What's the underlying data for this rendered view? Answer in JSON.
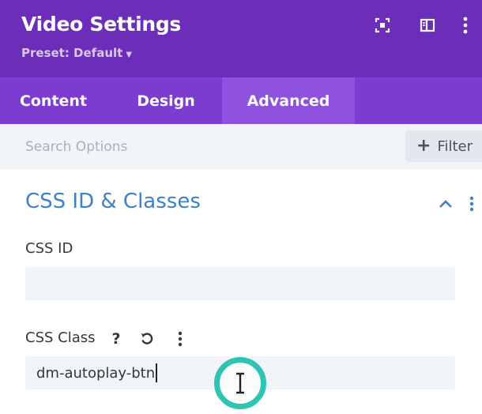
{
  "header": {
    "title": "Video Settings",
    "preset_label": "Preset: Default",
    "icons": [
      "focus-icon",
      "sidebar-icon",
      "more-vertical-icon"
    ],
    "colors": {
      "header_bg": "#6c2eb9",
      "tabs_bg": "#7d3cd0",
      "active_tab_bg": "#8e52de"
    }
  },
  "tabs": [
    {
      "label": "Content"
    },
    {
      "label": "Design"
    },
    {
      "label": "Advanced",
      "active": true
    }
  ],
  "search": {
    "placeholder": "Search Options",
    "filter_label": "Filter"
  },
  "section": {
    "title": "CSS ID & Classes",
    "title_color": "#3d81c7",
    "expanded": true
  },
  "fields": {
    "css_id": {
      "label": "CSS ID",
      "value": ""
    },
    "css_class": {
      "label": "CSS Class",
      "value": "dm-autoplay-btn",
      "icons": [
        "help-icon",
        "reset-icon",
        "more-vertical-icon"
      ]
    }
  },
  "cursor": {
    "type": "text-cursor",
    "highlight_color": "#2fc3b3"
  }
}
